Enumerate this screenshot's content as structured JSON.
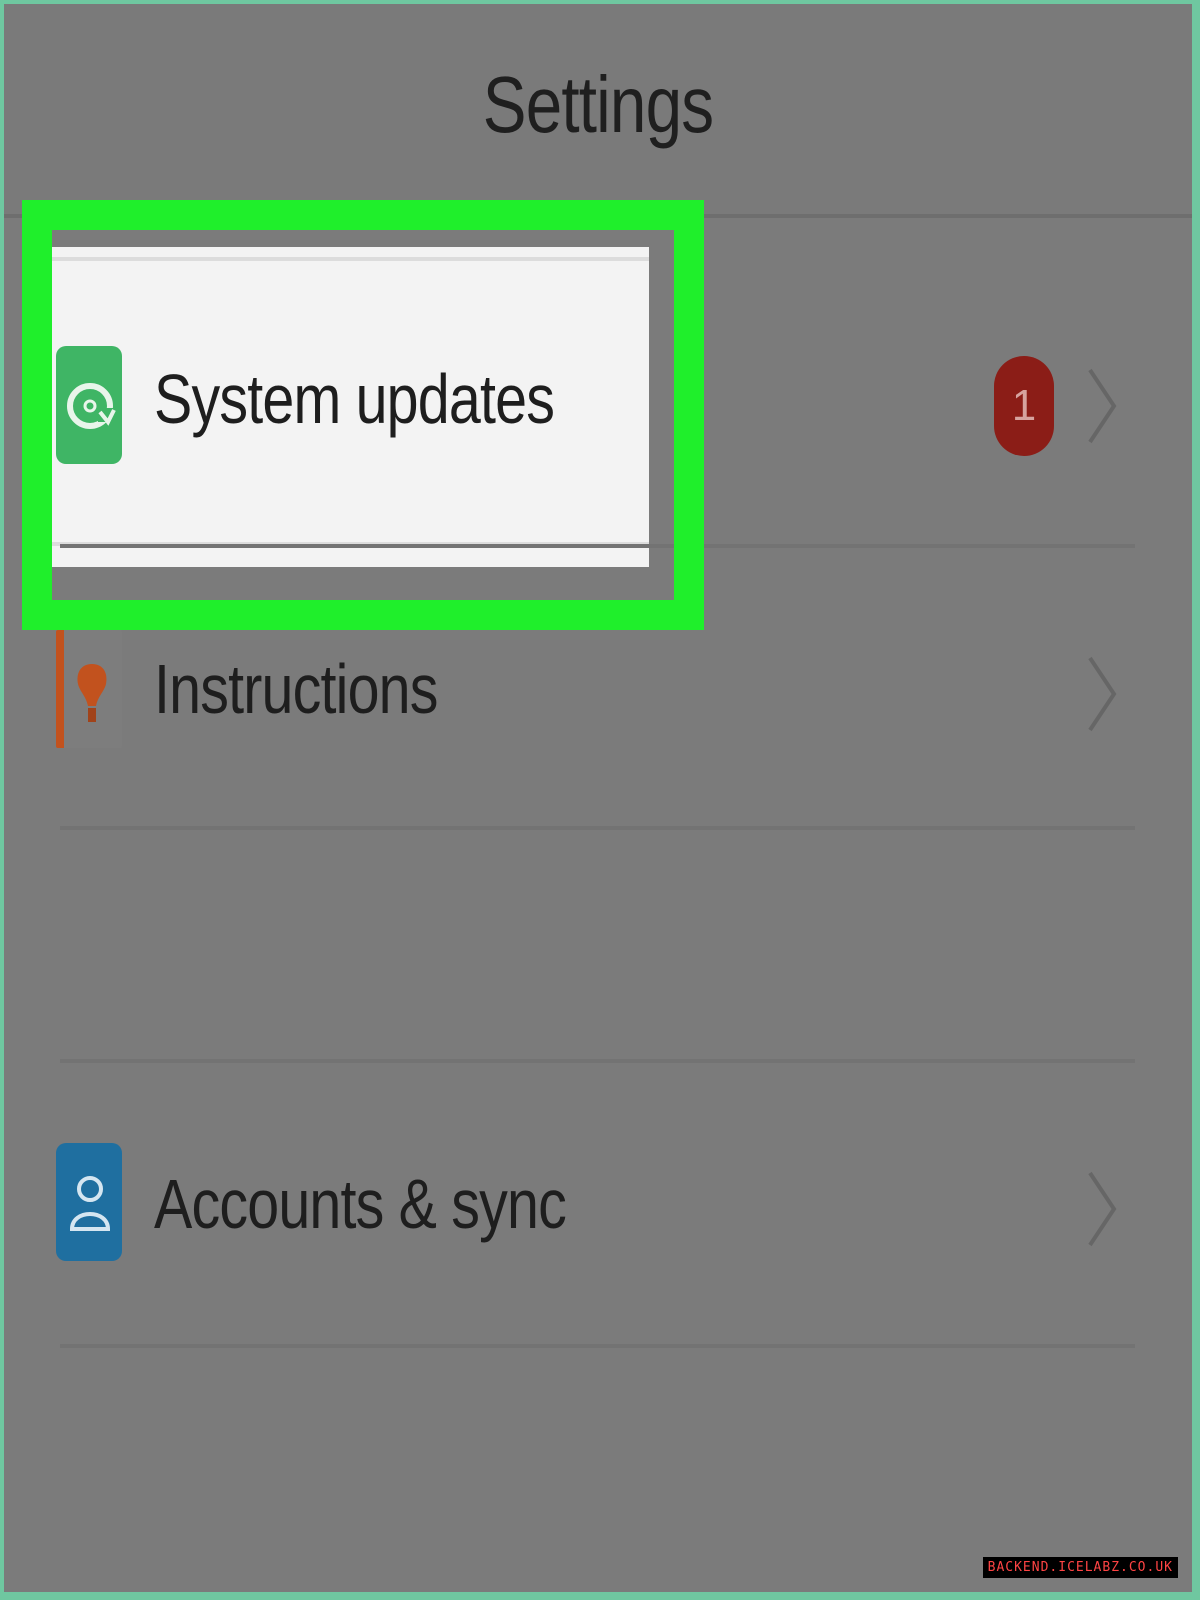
{
  "header": {
    "title": "Settings"
  },
  "items": [
    {
      "label": "System updates",
      "icon": "system-update-icon",
      "icon_color": "#3fb565",
      "badge": "1",
      "badge_color": "#8b1d17"
    },
    {
      "label": "Instructions",
      "icon": "lightbulb-icon",
      "icon_color": "#c2521e"
    },
    {
      "label": "Accounts & sync",
      "icon": "account-icon",
      "icon_color": "#1f6fa0"
    }
  ],
  "highlight_color": "#1fef2b",
  "watermark": "BACKEND.ICELABZ.CO.UK"
}
